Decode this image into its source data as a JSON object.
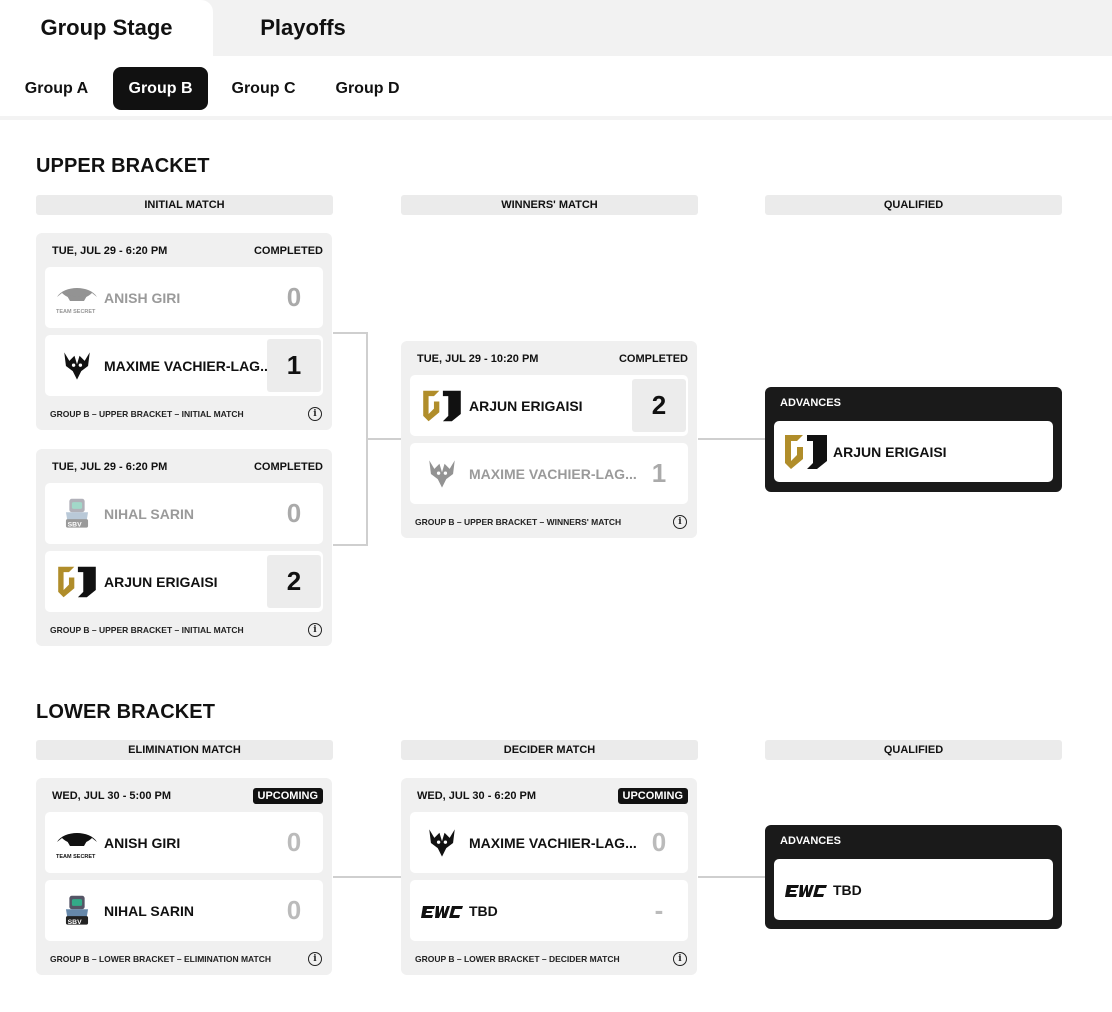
{
  "top_tabs": [
    "Group Stage",
    "Playoffs"
  ],
  "sub_tabs": [
    "Group A",
    "Group B",
    "Group C",
    "Group D"
  ],
  "upper": {
    "title": "UPPER BRACKET",
    "columns": [
      "INITIAL MATCH",
      "WINNERS' MATCH",
      "QUALIFIED"
    ],
    "m1": {
      "date": "TUE, JUL 29 - 6:20 PM",
      "status": "COMPLETED",
      "t1": {
        "name": "ANISH GIRI",
        "score": "0"
      },
      "t2": {
        "name": "MAXIME VACHIER-LAG...",
        "score": "1"
      },
      "foot": "GROUP B – UPPER BRACKET – INITIAL MATCH"
    },
    "m2": {
      "date": "TUE, JUL 29 - 6:20 PM",
      "status": "COMPLETED",
      "t1": {
        "name": "NIHAL SARIN",
        "score": "0"
      },
      "t2": {
        "name": "ARJUN ERIGAISI",
        "score": "2"
      },
      "foot": "GROUP B – UPPER BRACKET – INITIAL MATCH"
    },
    "m3": {
      "date": "TUE, JUL 29 - 10:20 PM",
      "status": "COMPLETED",
      "t1": {
        "name": "ARJUN ERIGAISI",
        "score": "2"
      },
      "t2": {
        "name": "MAXIME VACHIER-LAG...",
        "score": "1"
      },
      "foot": "GROUP B – UPPER BRACKET – WINNERS' MATCH"
    },
    "adv": {
      "label": "ADVANCES",
      "name": "ARJUN ERIGAISI"
    }
  },
  "lower": {
    "title": "LOWER BRACKET",
    "columns": [
      "ELIMINATION MATCH",
      "DECIDER MATCH",
      "QUALIFIED"
    ],
    "m1": {
      "date": "WED, JUL 30 - 5:00 PM",
      "status": "UPCOMING",
      "t1": {
        "name": "ANISH GIRI",
        "score": "0"
      },
      "t2": {
        "name": "NIHAL SARIN",
        "score": "0"
      },
      "foot": "GROUP B – LOWER BRACKET – ELIMINATION MATCH"
    },
    "m2": {
      "date": "WED, JUL 30 - 6:20 PM",
      "status": "UPCOMING",
      "t1": {
        "name": "MAXIME VACHIER-LAG...",
        "score": "0"
      },
      "t2": {
        "name": "TBD",
        "score": "-"
      },
      "foot": "GROUP B – LOWER BRACKET – DECIDER MATCH"
    },
    "adv": {
      "label": "ADVANCES",
      "name": "TBD"
    }
  },
  "info_glyph": "i",
  "logos": {
    "secret_text": "TEAM SECRET",
    "sbv_text": "SBV",
    "ewc_text": "EWC"
  },
  "colors": {
    "gold": "#b08d2a",
    "dark": "#111111",
    "card_bg": "#f0f0f0",
    "muted": "#9a9a9a"
  }
}
